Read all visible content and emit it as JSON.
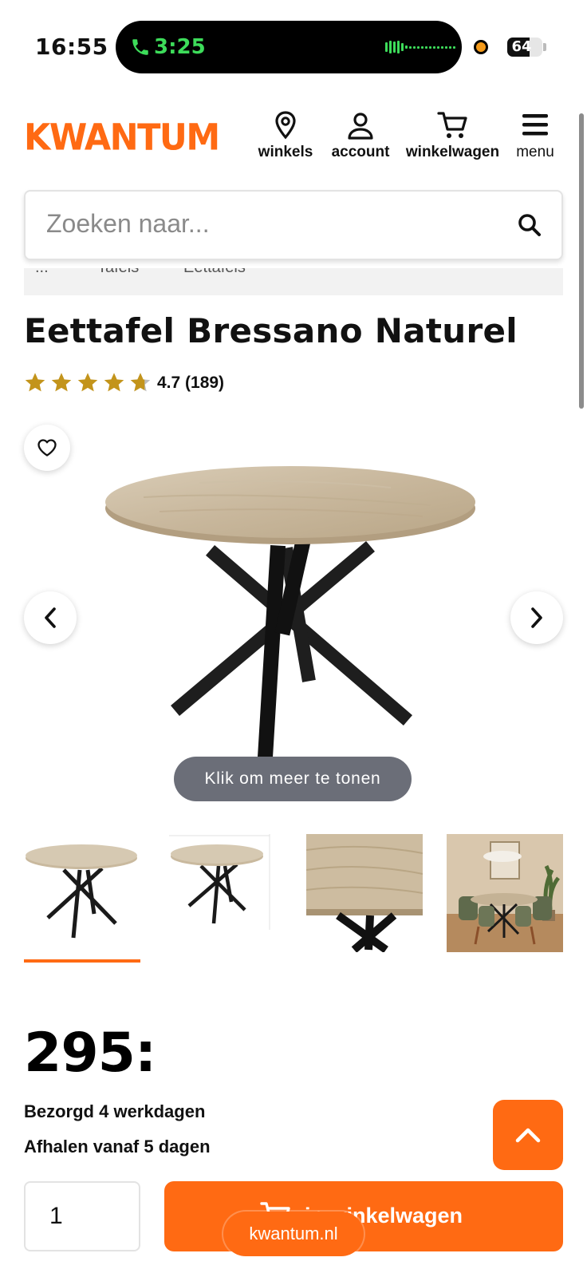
{
  "status_bar": {
    "time": "16:55",
    "call_timer": "3:25",
    "battery_level": "64",
    "battery_fraction": 0.64
  },
  "header": {
    "logo": "KWANTUM",
    "nav": [
      {
        "label": "winkels",
        "icon": "location-pin-icon"
      },
      {
        "label": "account",
        "icon": "user-icon"
      },
      {
        "label": "winkelwagen",
        "icon": "cart-icon"
      },
      {
        "label": "menu",
        "icon": "hamburger-icon"
      }
    ]
  },
  "search": {
    "placeholder": "Zoeken naar..."
  },
  "breadcrumb": [
    "...",
    "Tafels",
    "Eettafels"
  ],
  "product": {
    "title": "Eettafel Bressano Naturel",
    "rating": 4.7,
    "rating_text": "4.7 (189)",
    "show_more_label": "Klik om meer te tonen",
    "price": "295:",
    "delivery_home": "Bezorgd 4 werkdagen",
    "delivery_pickup": "Afhalen vanaf 5 dagen",
    "quantity": "1",
    "add_to_cart_label": "in winkelwagen"
  },
  "browser": {
    "url": "kwantum.nl"
  },
  "colors": {
    "brand_orange": "#ff6a13",
    "star_gold": "#c3941b",
    "call_green": "#3ddc5a"
  }
}
